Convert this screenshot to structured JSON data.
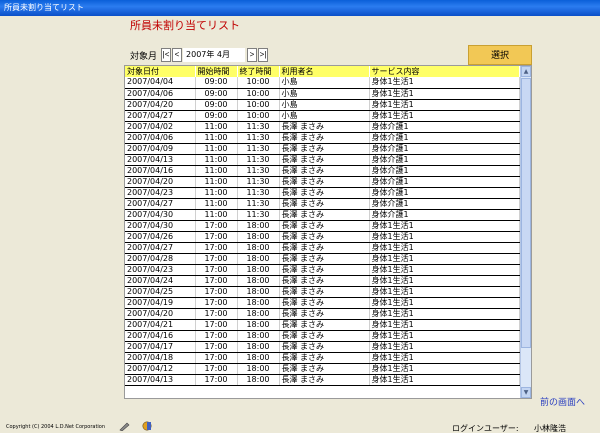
{
  "window": {
    "title": "所員未割り当てリスト"
  },
  "page": {
    "heading": "所員未割り当てリスト"
  },
  "month_nav": {
    "label": "対象月",
    "first": "|<",
    "prev": "<",
    "month": "2007年 4月",
    "next": ">",
    "last": ">|"
  },
  "select_button": "選択",
  "table": {
    "headers": [
      "対象日付",
      "開始時間",
      "終了時間",
      "利用者名",
      "サービス内容"
    ],
    "rows": [
      [
        "2007/04/04",
        "09:00",
        "10:00",
        "小島",
        "身体1生活1"
      ],
      [
        "2007/04/06",
        "09:00",
        "10:00",
        "小島",
        "身体1生活1"
      ],
      [
        "2007/04/20",
        "09:00",
        "10:00",
        "小島",
        "身体1生活1"
      ],
      [
        "2007/04/27",
        "09:00",
        "10:00",
        "小島",
        "身体1生活1"
      ],
      [
        "2007/04/02",
        "11:00",
        "11:30",
        "長澤 まさみ",
        "身体介護1"
      ],
      [
        "2007/04/06",
        "11:00",
        "11:30",
        "長澤 まさみ",
        "身体介護1"
      ],
      [
        "2007/04/09",
        "11:00",
        "11:30",
        "長澤 まさみ",
        "身体介護1"
      ],
      [
        "2007/04/13",
        "11:00",
        "11:30",
        "長澤 まさみ",
        "身体介護1"
      ],
      [
        "2007/04/16",
        "11:00",
        "11:30",
        "長澤 まさみ",
        "身体介護1"
      ],
      [
        "2007/04/20",
        "11:00",
        "11:30",
        "長澤 まさみ",
        "身体介護1"
      ],
      [
        "2007/04/23",
        "11:00",
        "11:30",
        "長澤 まさみ",
        "身体介護1"
      ],
      [
        "2007/04/27",
        "11:00",
        "11:30",
        "長澤 まさみ",
        "身体介護1"
      ],
      [
        "2007/04/30",
        "11:00",
        "11:30",
        "長澤 まさみ",
        "身体介護1"
      ],
      [
        "2007/04/30",
        "17:00",
        "18:00",
        "長澤 まさみ",
        "身体1生活1"
      ],
      [
        "2007/04/26",
        "17:00",
        "18:00",
        "長澤 まさみ",
        "身体1生活1"
      ],
      [
        "2007/04/27",
        "17:00",
        "18:00",
        "長澤 まさみ",
        "身体1生活1"
      ],
      [
        "2007/04/28",
        "17:00",
        "18:00",
        "長澤 まさみ",
        "身体1生活1"
      ],
      [
        "2007/04/23",
        "17:00",
        "18:00",
        "長澤 まさみ",
        "身体1生活1"
      ],
      [
        "2007/04/24",
        "17:00",
        "18:00",
        "長澤 まさみ",
        "身体1生活1"
      ],
      [
        "2007/04/25",
        "17:00",
        "18:00",
        "長澤 まさみ",
        "身体1生活1"
      ],
      [
        "2007/04/19",
        "17:00",
        "18:00",
        "長澤 まさみ",
        "身体1生活1"
      ],
      [
        "2007/04/20",
        "17:00",
        "18:00",
        "長澤 まさみ",
        "身体1生活1"
      ],
      [
        "2007/04/21",
        "17:00",
        "18:00",
        "長澤 まさみ",
        "身体1生活1"
      ],
      [
        "2007/04/16",
        "17:00",
        "18:00",
        "長澤 まさみ",
        "身体1生活1"
      ],
      [
        "2007/04/17",
        "17:00",
        "18:00",
        "長澤 まさみ",
        "身体1生活1"
      ],
      [
        "2007/04/18",
        "17:00",
        "18:00",
        "長澤 まさみ",
        "身体1生活1"
      ],
      [
        "2007/04/12",
        "17:00",
        "18:00",
        "長澤 まさみ",
        "身体1生活1"
      ],
      [
        "2007/04/13",
        "17:00",
        "18:00",
        "長澤 まさみ",
        "身体1生活1"
      ]
    ]
  },
  "back_link": "前の画面へ",
  "footer": {
    "copyright": "Copyright (C) 2004 L.D.Net Corporation",
    "login_label": "ログインユーザー:",
    "login_user": "小林隆浩",
    "icons": [
      "pen-icon",
      "disk-icon"
    ]
  },
  "colors": {
    "header_bg": "#ffff66",
    "heading": "#c00000",
    "select_button": "#f2c855",
    "link": "#2a3fbf"
  }
}
